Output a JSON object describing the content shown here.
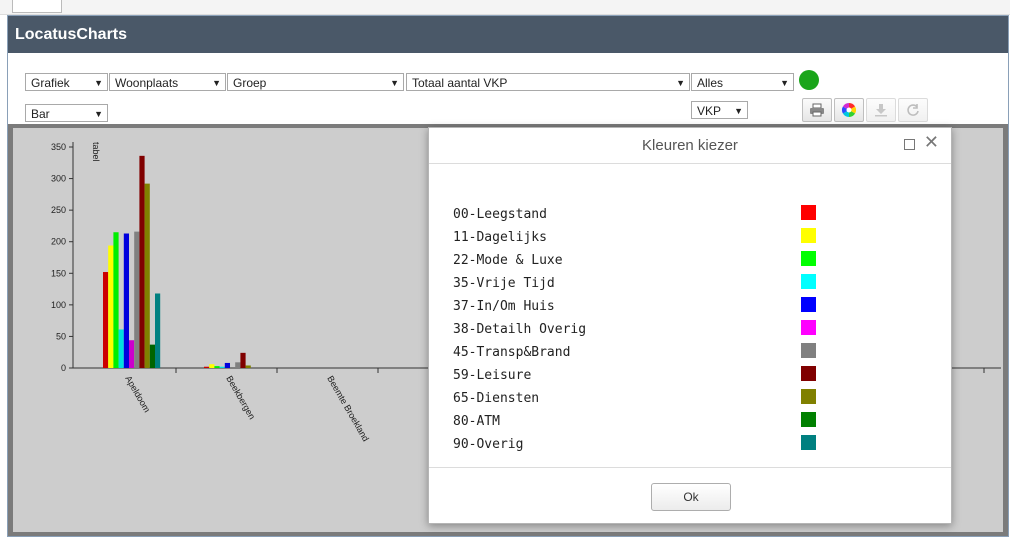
{
  "app": {
    "title": "LocatusCharts"
  },
  "toolbar": {
    "type_select": "Grafiek",
    "place_select": "Woonplaats",
    "group_select": "Groep",
    "measure_select": "Totaal aantal VKP",
    "scope_select": "Alles",
    "chart_style_select": "Bar",
    "unit_select": "VKP"
  },
  "status_color": "#1aa51a",
  "chart_data": {
    "type": "bar",
    "ylabel": "tabel",
    "ylim": [
      0,
      350
    ],
    "yticks": [
      "0",
      "50",
      "100",
      "150",
      "200",
      "250",
      "300",
      "350"
    ],
    "categories": [
      "Apeldoom",
      "Beekbergen",
      "Beemte Broekland"
    ],
    "series": [
      {
        "name": "00-Leegstand",
        "color": "#cc0000",
        "values": [
          152,
          2,
          0
        ]
      },
      {
        "name": "11-Dagelijks",
        "color": "#ffff00",
        "values": [
          194,
          6,
          0
        ]
      },
      {
        "name": "22-Mode & Luxe",
        "color": "#00ee00",
        "values": [
          215,
          3,
          0
        ]
      },
      {
        "name": "35-Vrije Tijd",
        "color": "#00e0e0",
        "values": [
          61,
          2,
          0
        ]
      },
      {
        "name": "37-In/Om Huis",
        "color": "#0000dd",
        "values": [
          213,
          8,
          0
        ]
      },
      {
        "name": "38-Detailh Overig",
        "color": "#cc00cc",
        "values": [
          44,
          0,
          0
        ]
      },
      {
        "name": "45-Transp&Brand",
        "color": "#808080",
        "values": [
          216,
          9,
          0
        ]
      },
      {
        "name": "59-Leisure",
        "color": "#800000",
        "values": [
          336,
          24,
          0
        ]
      },
      {
        "name": "65-Diensten",
        "color": "#808000",
        "values": [
          292,
          4,
          0
        ]
      },
      {
        "name": "80-ATM",
        "color": "#006400",
        "values": [
          37,
          0,
          0
        ]
      },
      {
        "name": "90-Overig",
        "color": "#008080",
        "values": [
          118,
          0,
          0
        ]
      }
    ]
  },
  "dialog": {
    "title": "Kleuren kiezer",
    "ok_label": "Ok",
    "colors": [
      {
        "label": "00-Leegstand",
        "color": "#ff0000"
      },
      {
        "label": "11-Dagelijks",
        "color": "#ffff00"
      },
      {
        "label": "22-Mode & Luxe",
        "color": "#00ff00"
      },
      {
        "label": "35-Vrije Tijd",
        "color": "#00ffff"
      },
      {
        "label": "37-In/Om Huis",
        "color": "#0000ff"
      },
      {
        "label": "38-Detailh Overig",
        "color": "#ff00ff"
      },
      {
        "label": "45-Transp&Brand",
        "color": "#808080"
      },
      {
        "label": "59-Leisure",
        "color": "#800000"
      },
      {
        "label": "65-Diensten",
        "color": "#808000"
      },
      {
        "label": "80-ATM",
        "color": "#008000"
      },
      {
        "label": "90-Overig",
        "color": "#008080"
      }
    ]
  }
}
